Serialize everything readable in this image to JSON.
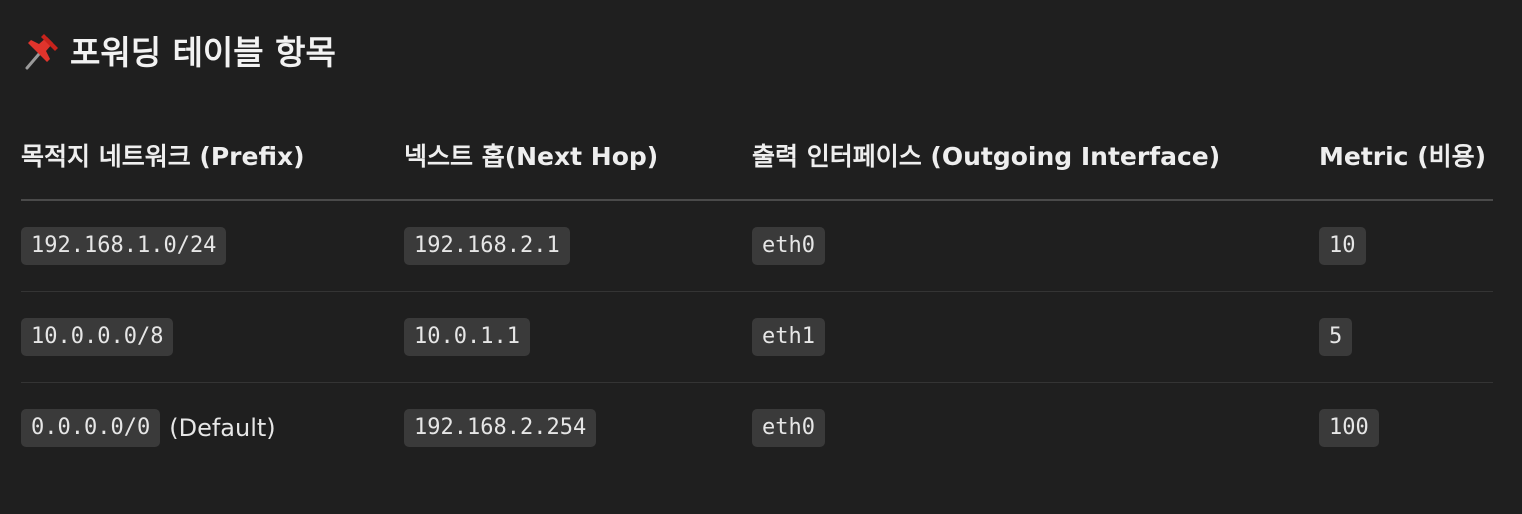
{
  "heading": {
    "icon": "pushpin-icon",
    "title": "포워딩 테이블 항목"
  },
  "table": {
    "columns": [
      "목적지 네트워크 (Prefix)",
      "넥스트 홉(Next Hop)",
      "출력 인터페이스 (Outgoing Interface)",
      "Metric (비용)"
    ],
    "rows": [
      {
        "prefix": "192.168.1.0/24",
        "prefix_note": "",
        "next_hop": "192.168.2.1",
        "interface": "eth0",
        "metric": "10"
      },
      {
        "prefix": "10.0.0.0/8",
        "prefix_note": "",
        "next_hop": "10.0.1.1",
        "interface": "eth1",
        "metric": "5"
      },
      {
        "prefix": "0.0.0.0/0",
        "prefix_note": "(Default)",
        "next_hop": "192.168.2.254",
        "interface": "eth0",
        "metric": "100"
      }
    ]
  }
}
